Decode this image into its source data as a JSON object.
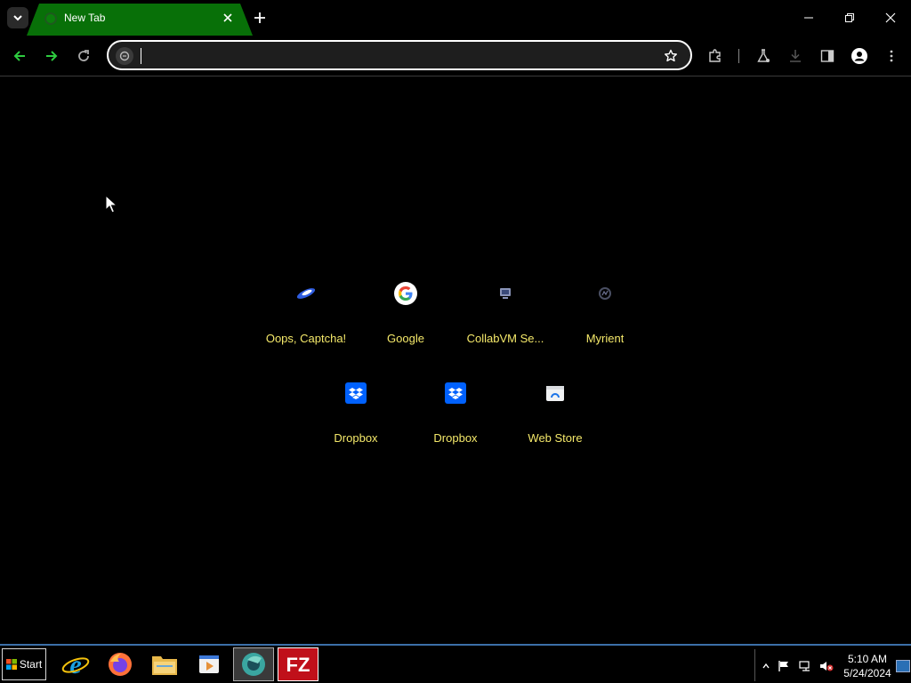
{
  "browser": {
    "tab": {
      "title": "New Tab"
    },
    "omnibox": {
      "value": "",
      "placeholder": ""
    }
  },
  "shortcuts": [
    {
      "label": "Oops, Captcha!",
      "icon": "oops-captcha-favicon-icon"
    },
    {
      "label": "Google",
      "icon": "google-icon"
    },
    {
      "label": "CollabVM Se...",
      "icon": "collabvm-favicon-icon"
    },
    {
      "label": "Myrient",
      "icon": "myrient-favicon-icon"
    },
    {
      "label": "Dropbox",
      "icon": "dropbox-icon"
    },
    {
      "label": "Dropbox",
      "icon": "dropbox-icon"
    },
    {
      "label": "Web Store",
      "icon": "web-store-icon"
    }
  ],
  "taskbar": {
    "start_label": "Start",
    "apps": [
      "internet-explorer",
      "firefox",
      "file-explorer",
      "media-player",
      "chromium",
      "filezilla"
    ],
    "clock": {
      "time": "5:10 AM",
      "date": "5/24/2024"
    }
  },
  "colors": {
    "tab_active": "#087008",
    "nav_green": "#2ecc40",
    "shortcut_label": "#f5e96a",
    "taskbar_border": "#3c6fa8"
  }
}
